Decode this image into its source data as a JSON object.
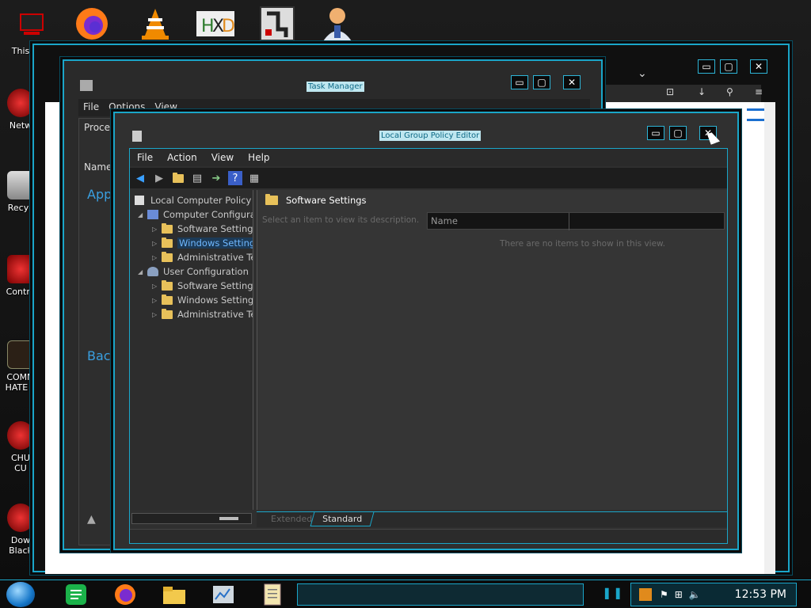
{
  "desktop": {
    "top_icons": [
      "firefox-icon",
      "vlc-icon",
      "hxd-icon",
      "app-icon",
      "user-icon"
    ],
    "left_icons": [
      {
        "label": "This",
        "icon": "computer-icon"
      },
      {
        "label": "Netw",
        "icon": "network-icon"
      },
      {
        "label": "Recyc",
        "icon": "recycle-bin-icon"
      },
      {
        "label": "Contro",
        "icon": "control-panel-icon"
      },
      {
        "label": "COMM\nHATE T",
        "icon": "document-icon"
      },
      {
        "label": "CHU\nCU",
        "icon": "app-icon"
      },
      {
        "label": "Dow\nBlack",
        "icon": "download-icon"
      }
    ]
  },
  "task_manager": {
    "title": "Task Manager",
    "menu": [
      "File",
      "Options",
      "View"
    ],
    "tab_partial": "Proces",
    "column_partial": "Name",
    "section_apps": "App",
    "section_back": "Back"
  },
  "gpedit": {
    "title": "Local Group Policy Editor",
    "menu": [
      "File",
      "Action",
      "View",
      "Help"
    ],
    "tree": [
      {
        "label": "Local Computer Policy",
        "level": 0
      },
      {
        "label": "Computer Configurati",
        "level": 1
      },
      {
        "label": "Software Settings",
        "level": 2
      },
      {
        "label": "Windows Settings",
        "level": 2,
        "selected": true
      },
      {
        "label": "Administrative Ten",
        "level": 2
      },
      {
        "label": "User Configuration",
        "level": 1
      },
      {
        "label": "Software Settings",
        "level": 2
      },
      {
        "label": "Windows Settings",
        "level": 2
      },
      {
        "label": "Administrative Ten",
        "level": 2
      }
    ],
    "header_title": "Software Settings",
    "description_hint": "Select an item to view its description.",
    "column_name": "Name",
    "empty_text": "There are no items to show in this view.",
    "tabs": [
      "Extended",
      "Standard"
    ]
  },
  "taskbar": {
    "clock": "12:53 PM"
  }
}
